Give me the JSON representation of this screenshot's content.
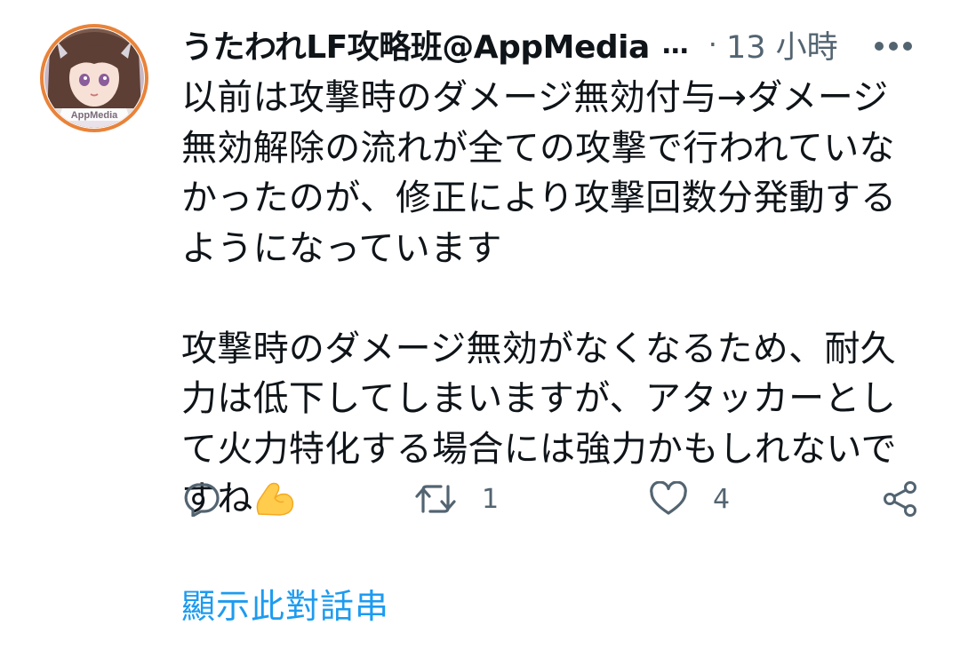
{
  "tweet": {
    "author": {
      "display_name": "うたわれLF攻略班@AppMedia",
      "truncation": "…",
      "avatar_text": "AppMedia"
    },
    "separator": "·",
    "time": "13 小時",
    "text_part1": "以前は攻撃時のダメージ無効付与→ダメージ無効解除の流れが全ての攻撃で行われていなかったのが、修正により攻撃回数分発動するようになっています\n\n攻撃時のダメージ無効がなくなるため、耐久力は低下してしまいますが、アタッカーとして火力特化する場合には強力かもしれないですね",
    "emoji": "flexed-biceps-emoji",
    "icons": {
      "more": "more-icon",
      "reply": "reply-icon",
      "retweet": "retweet-icon",
      "like": "like-icon",
      "share": "share-icon"
    },
    "actions": {
      "reply_count": "",
      "retweet_count": "1",
      "like_count": "4"
    },
    "show_thread_label": "顯示此對話串"
  },
  "colors": {
    "text": "#0f1419",
    "secondary": "#536471",
    "link": "#1d9bf0",
    "avatar_ring": "#e8833a"
  }
}
